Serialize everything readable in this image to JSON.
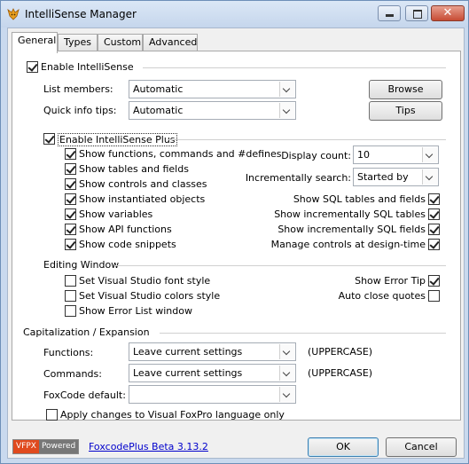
{
  "window": {
    "title": "IntelliSense Manager",
    "close_glyph": "✕"
  },
  "tabs": [
    {
      "label": "General"
    },
    {
      "label": "Types"
    },
    {
      "label": "Custom"
    },
    {
      "label": "Advanced"
    }
  ],
  "general": {
    "enable_intellisense": {
      "label": "Enable IntelliSense",
      "checked": true
    },
    "list_members": {
      "label": "List members:",
      "value": "Automatic"
    },
    "quick_info_tips": {
      "label": "Quick info tips:",
      "value": "Automatic"
    },
    "browse_label": "Browse",
    "tips_label": "Tips",
    "enable_plus": {
      "label": "Enable IntelliSense Plus",
      "checked": true
    },
    "plus_left": [
      {
        "label": "Show functions, commands and #defines",
        "checked": true
      },
      {
        "label": "Show tables and fields",
        "checked": true
      },
      {
        "label": "Show controls and classes",
        "checked": true
      },
      {
        "label": "Show instantiated objects",
        "checked": true
      },
      {
        "label": "Show variables",
        "checked": true
      },
      {
        "label": "Show API functions",
        "checked": true
      },
      {
        "label": "Show code snippets",
        "checked": true
      }
    ],
    "display_count": {
      "label": "Display count:",
      "value": "10"
    },
    "incremental_search": {
      "label": "Incrementally search:",
      "value": "Started by"
    },
    "plus_right": [
      {
        "label": "Show SQL tables and fields",
        "checked": true
      },
      {
        "label": "Show incrementally SQL tables",
        "checked": true
      },
      {
        "label": "Show incrementally SQL fields",
        "checked": true
      },
      {
        "label": "Manage controls at design-time",
        "checked": true
      }
    ],
    "editing_window": {
      "title": "Editing Window",
      "left": [
        {
          "label": "Set Visual Studio font style",
          "checked": false
        },
        {
          "label": "Set Visual Studio colors style",
          "checked": false
        },
        {
          "label": "Show Error List window",
          "checked": false
        }
      ],
      "right": [
        {
          "label": "Show Error Tip",
          "checked": true
        },
        {
          "label": "Auto close quotes",
          "checked": false
        }
      ]
    },
    "capitalization": {
      "title": "Capitalization / Expansion",
      "functions": {
        "label": "Functions:",
        "value": "Leave current settings",
        "hint": "(UPPERCASE)"
      },
      "commands": {
        "label": "Commands:",
        "value": "Leave current settings",
        "hint": "(UPPERCASE)"
      },
      "foxcode_default": {
        "label": "FoxCode default:",
        "value": ""
      },
      "apply_changes": {
        "label": "Apply changes to Visual FoxPro language only",
        "checked": false
      }
    }
  },
  "footer": {
    "logo_left": "VFPX",
    "logo_right": "Powered",
    "version_link": "FoxcodePlus Beta 3.13.2",
    "ok_label": "OK",
    "cancel_label": "Cancel"
  }
}
